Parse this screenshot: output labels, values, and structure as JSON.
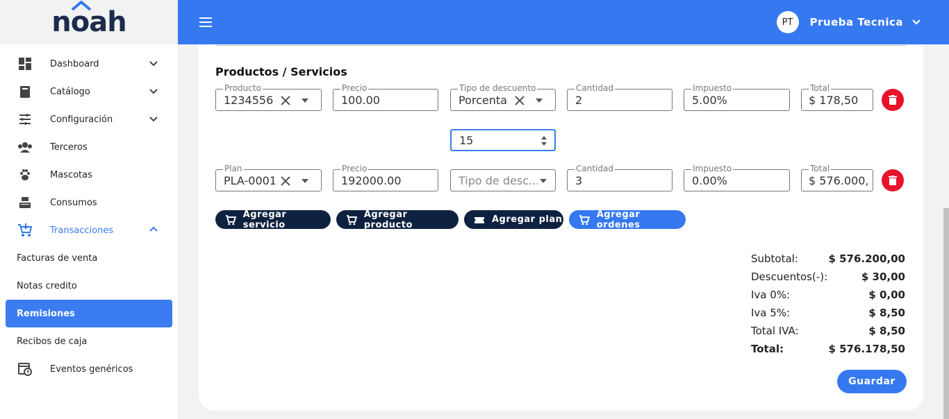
{
  "brand": {
    "logo_text": "noah"
  },
  "topbar": {
    "avatar_initials": "PT",
    "user_name": "Prueba Tecnica"
  },
  "sidebar": {
    "items": [
      {
        "label": "Dashboard",
        "icon": "dashboard-icon",
        "expandable": true
      },
      {
        "label": "Catálogo",
        "icon": "catalog-icon",
        "expandable": true
      },
      {
        "label": "Configuración",
        "icon": "settings-sliders-icon",
        "expandable": true
      },
      {
        "label": "Terceros",
        "icon": "people-icon",
        "expandable": false
      },
      {
        "label": "Mascotas",
        "icon": "paw-icon",
        "expandable": false
      },
      {
        "label": "Consumos",
        "icon": "cash-register-icon",
        "expandable": false
      },
      {
        "label": "Transacciones",
        "icon": "cart-icon",
        "expandable": true,
        "expanded": true
      }
    ],
    "subitems": [
      {
        "label": "Facturas de venta"
      },
      {
        "label": "Notas credito"
      },
      {
        "label": "Remisiones",
        "selected": true
      },
      {
        "label": "Recibos de caja"
      }
    ],
    "events": {
      "label": "Eventos genéricos",
      "icon": "calendar-clock-icon"
    }
  },
  "main": {
    "section_title": "Productos / Servicios",
    "row1": {
      "product": {
        "label": "Producto",
        "value": "1234556 -"
      },
      "price": {
        "label": "Precio",
        "value": "100.00"
      },
      "discount_type": {
        "label": "Tipo de descuento",
        "value": "Porcenta"
      },
      "quantity": {
        "label": "Cantidad",
        "value": "2"
      },
      "tax": {
        "label": "Impuesto",
        "value": "5.00%"
      },
      "total": {
        "label": "Total",
        "value": "$ 178,50"
      },
      "discount_value": "15"
    },
    "row2": {
      "plan": {
        "label": "Plan",
        "value": "PLA-0001"
      },
      "price": {
        "label": "Precio",
        "value": "192000.00"
      },
      "discount_type": {
        "placeholder": "Tipo de desc..."
      },
      "quantity": {
        "label": "Cantidad",
        "value": "3"
      },
      "tax": {
        "label": "Impuesto",
        "value": "0.00%"
      },
      "total": {
        "label": "Total",
        "value": "$ 576.000,"
      }
    },
    "buttons": {
      "add_service": "Agregar servicio",
      "add_product": "Agregar producto",
      "add_plan": "Agregar plan",
      "add_orders": "Agregar ordenes"
    },
    "totals": [
      {
        "label": "Subtotal:",
        "value": "$ 576.200,00"
      },
      {
        "label": "Descuentos(-):",
        "value": "$ 30,00"
      },
      {
        "label": "Iva 0%:",
        "value": "$ 0,00"
      },
      {
        "label": "Iva 5%:",
        "value": "$ 8,50"
      },
      {
        "label": "Total IVA:",
        "value": "$ 8,50"
      },
      {
        "label": "Total:",
        "value": "$ 576.178,50"
      }
    ],
    "save_label": "Guardar"
  },
  "colors": {
    "primary": "#3678f0",
    "dark_button": "#0e2240",
    "delete": "#e8122a"
  }
}
